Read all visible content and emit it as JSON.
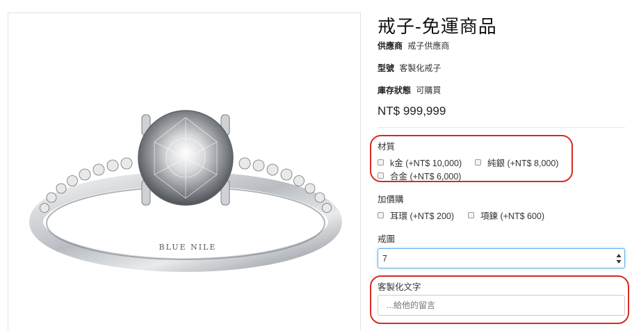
{
  "product": {
    "image_alt": "BLUE NILE diamond solitaire engagement ring",
    "ring_engraving": "BLUE NILE",
    "title": "戒子-免運商品",
    "supplier_label": "供應商",
    "supplier_value": "戒子供應商",
    "model_label": "型號",
    "model_value": "客製化戒子",
    "stock_label": "庫存狀態",
    "stock_value": "可購買",
    "price": "NT$ 999,999"
  },
  "material": {
    "label": "材質",
    "options": [
      {
        "label": "k金 (+NT$ 10,000)",
        "checked": false
      },
      {
        "label": "純銀 (+NT$ 8,000)",
        "checked": false
      },
      {
        "label": "合金 (+NT$ 6,000)",
        "checked": false
      }
    ]
  },
  "addon": {
    "label": "加價購",
    "options": [
      {
        "label": "耳環 (+NT$ 200)",
        "checked": false
      },
      {
        "label": "項鍊 (+NT$ 600)",
        "checked": false
      }
    ]
  },
  "ring_size": {
    "label": "戒圍",
    "selected": "7"
  },
  "custom_text": {
    "label": "客製化文字",
    "placeholder": "...給他的留言",
    "value": ""
  },
  "colors": {
    "annotation": "#d62a24",
    "focus_border": "#66afe9",
    "metal": "#c9ccd0"
  },
  "icons": {
    "checkbox": "checkbox-icon",
    "select": "select-arrows-icon"
  }
}
